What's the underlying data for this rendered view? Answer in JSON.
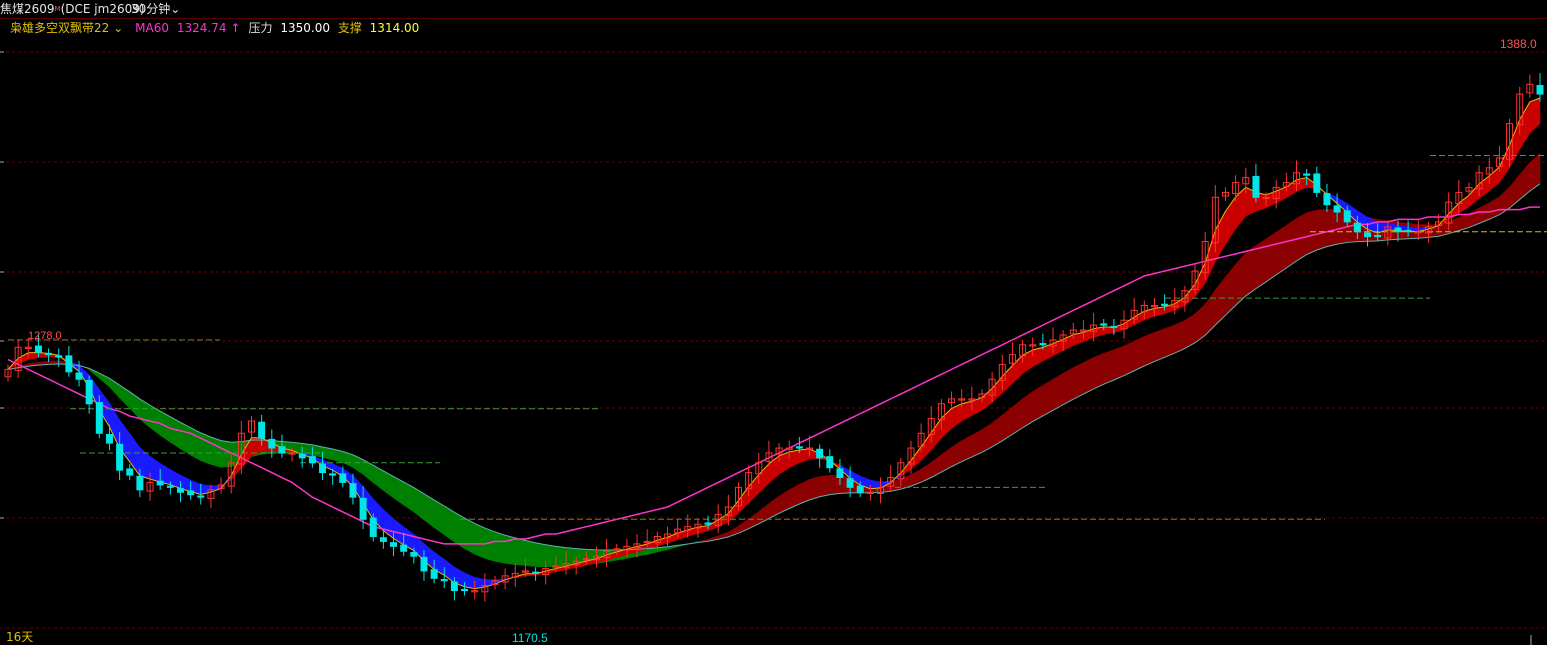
{
  "header": {
    "symbol": "焦煤2609",
    "superscript": "M",
    "exchange": "(DCE  jm2609)",
    "interval": "30分钟",
    "interval_chevron": "chevron-down-icon"
  },
  "legend": {
    "indicator": "枭雄多空双飘带22",
    "indicator_chevron": "chevron-down-icon",
    "ma_label": "MA60",
    "ma_value": "1324.74",
    "ma_arrow": "↑",
    "resistance_label": "压力",
    "resistance_value": "1350.00",
    "support_label": "支撑",
    "support_value": "1314.00"
  },
  "footer": {
    "timeframe_label": "16天"
  },
  "colors": {
    "up": "#ff3030",
    "down": "#00e5e5",
    "ma60": "#ff33cc",
    "fast_band_bull": "#c80000",
    "fast_band_bear": "#1a1aff",
    "slow_band_bull": "#8b0000",
    "slow_band_bear": "#008000",
    "level_line": "#9a9a00",
    "grid": "#6a0000"
  },
  "chart_data": {
    "type": "candlestick",
    "title": "",
    "xlabel": "",
    "ylabel": "",
    "ylim": [
      1162,
      1400
    ],
    "high_label": "1388.0",
    "low_label": "1170.5",
    "left_marker_label": "1278.0",
    "close": [
      1266,
      1275,
      1275,
      1273,
      1272,
      1271,
      1265,
      1262,
      1252,
      1240,
      1236,
      1225,
      1223,
      1217,
      1220,
      1219,
      1218,
      1216,
      1215,
      1214,
      1217,
      1219,
      1228,
      1240,
      1245,
      1238,
      1234,
      1232,
      1232,
      1230,
      1228,
      1224,
      1223,
      1220,
      1214,
      1205,
      1198,
      1196,
      1194,
      1192,
      1190,
      1184,
      1181,
      1180,
      1176,
      1176,
      1176,
      1178,
      1180,
      1182,
      1183,
      1184,
      1183,
      1185,
      1186,
      1187,
      1188,
      1189,
      1190,
      1192,
      1193,
      1194,
      1195,
      1196,
      1198,
      1199,
      1201,
      1202,
      1203,
      1203,
      1207,
      1210,
      1218,
      1224,
      1228,
      1232,
      1234,
      1234,
      1234,
      1234,
      1230,
      1226,
      1222,
      1218,
      1216,
      1216,
      1218,
      1222,
      1228,
      1234,
      1240,
      1246,
      1252,
      1254,
      1254,
      1254,
      1256,
      1262,
      1268,
      1272,
      1276,
      1276,
      1276,
      1278,
      1280,
      1282,
      1282,
      1284,
      1284,
      1283,
      1286,
      1290,
      1292,
      1292,
      1292,
      1294,
      1298,
      1306,
      1318,
      1336,
      1338,
      1342,
      1344,
      1336,
      1336,
      1340,
      1342,
      1346,
      1345,
      1338,
      1333,
      1330,
      1326,
      1322,
      1320,
      1320,
      1324,
      1322,
      1322,
      1322,
      1324,
      1326,
      1334,
      1338,
      1340,
      1346,
      1348,
      1352,
      1366,
      1378,
      1382,
      1378
    ],
    "series": [
      {
        "name": "MA60",
        "values": [
          1270,
          1268,
          1266,
          1264,
          1262,
          1260,
          1258,
          1256,
          1254,
          1252,
          1250,
          1249,
          1247,
          1246,
          1245,
          1244,
          1242,
          1241,
          1240,
          1238,
          1236,
          1234,
          1232,
          1230,
          1228,
          1226,
          1224,
          1222,
          1220,
          1217,
          1214,
          1212,
          1210,
          1208,
          1206,
          1204,
          1202,
          1201,
          1200,
          1199,
          1198,
          1197,
          1196,
          1195,
          1195,
          1195,
          1195,
          1195,
          1196,
          1196,
          1197,
          1197,
          1198,
          1199,
          1199,
          1200,
          1201,
          1202,
          1203,
          1204,
          1205,
          1206,
          1207,
          1208,
          1209,
          1210,
          1212,
          1214,
          1216,
          1218,
          1220,
          1222,
          1224,
          1226,
          1228,
          1230,
          1232,
          1234,
          1236,
          1238,
          1240,
          1242,
          1244,
          1246,
          1248,
          1250,
          1252,
          1254,
          1256,
          1258,
          1260,
          1262,
          1264,
          1266,
          1268,
          1270,
          1272,
          1274,
          1276,
          1278,
          1280,
          1282,
          1284,
          1286,
          1288,
          1290,
          1292,
          1294,
          1296,
          1298,
          1300,
          1302,
          1304,
          1305,
          1306,
          1307,
          1308,
          1309,
          1310,
          1311,
          1312,
          1313,
          1314,
          1315,
          1316,
          1317,
          1318,
          1319,
          1320,
          1321,
          1322,
          1323,
          1324,
          1325,
          1325,
          1326,
          1326,
          1327,
          1327,
          1327,
          1328,
          1328,
          1328,
          1329,
          1329,
          1330,
          1330,
          1331,
          1331,
          1331,
          1332,
          1332
        ]
      }
    ],
    "levels": [
      1278,
      1250,
      1232,
      1228,
      1205,
      1218,
      1295,
      1322,
      1353
    ]
  }
}
